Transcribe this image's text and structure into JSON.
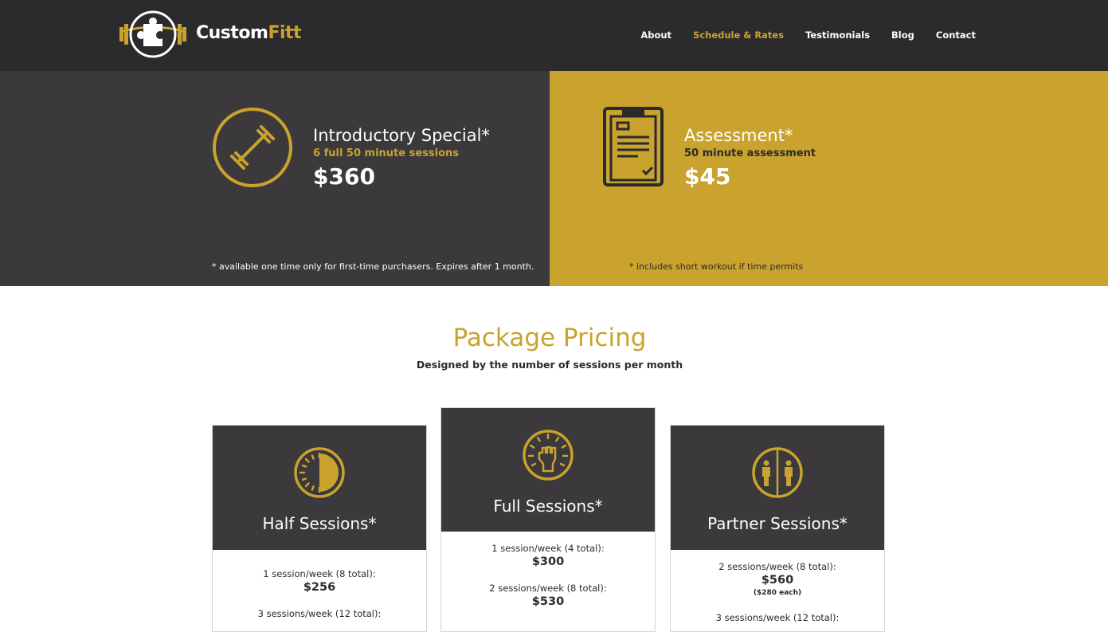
{
  "brand": {
    "name_part1": "Custom",
    "name_part2": "Fitt",
    "accent_color": "#c9a32e",
    "dark_color": "#2b2a2c",
    "logo_icon": "puzzle-barbell-logo-icon"
  },
  "nav": {
    "items": [
      {
        "label": "About"
      },
      {
        "label": "Schedule & Rates"
      },
      {
        "label": "Testimonials"
      },
      {
        "label": "Blog"
      },
      {
        "label": "Contact"
      }
    ],
    "active": "Schedule & Rates"
  },
  "promos": {
    "intro": {
      "icon": "dumbbell-icon",
      "title": "Introductory Special*",
      "subtitle": "6 full 50 minute sessions",
      "price": "$360",
      "note": "* available one time only for first-time purchasers. Expires after 1 month."
    },
    "assessment": {
      "icon": "clipboard-icon",
      "title": "Assessment*",
      "subtitle": "50 minute assessment",
      "price": "$45",
      "note": "* includes short workout if time permits"
    }
  },
  "packages": {
    "title": "Package Pricing",
    "subtitle": "Designed by the number of sessions per month",
    "cards": [
      {
        "icon": "half-timer-icon",
        "name": "Half Sessions*",
        "tiers": [
          {
            "label": "1 session/week (8 total):",
            "price": "$256"
          },
          {
            "label": "3 sessions/week (12 total):"
          }
        ]
      },
      {
        "icon": "raised-fist-icon",
        "name": "Full Sessions*",
        "tiers": [
          {
            "label": "1 session/week (4 total):",
            "price": "$300"
          },
          {
            "label": "2 sessions/week (8 total):",
            "price": "$530"
          }
        ]
      },
      {
        "icon": "partners-icon",
        "name": "Partner Sessions*",
        "tiers": [
          {
            "label": "2 sessions/week (8 total):",
            "price": "$560",
            "each": "($280 each)"
          },
          {
            "label": "3 sessions/week (12 total):"
          }
        ]
      }
    ]
  }
}
